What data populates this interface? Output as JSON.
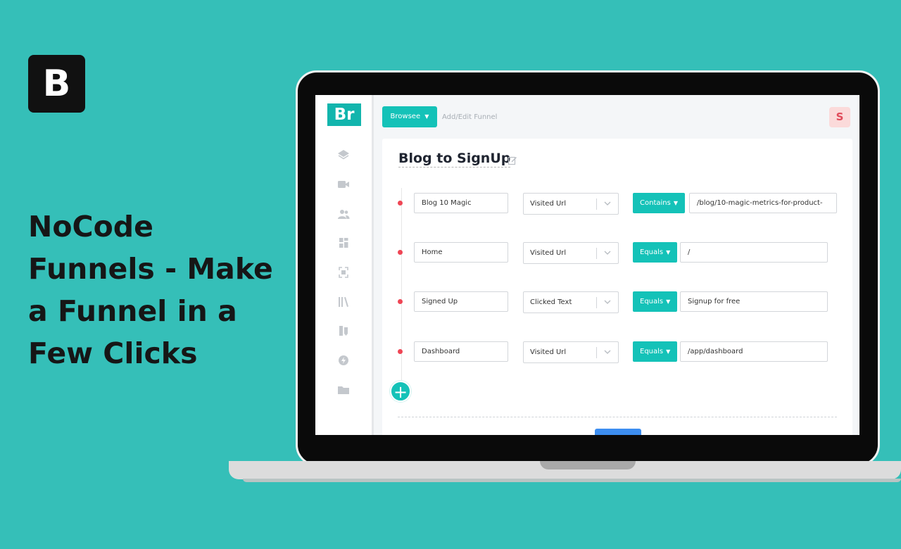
{
  "brand": {
    "badge_letter": "B"
  },
  "headline": {
    "text": "NoCode Funnels - Make a Funnel in a Few Clicks"
  },
  "app": {
    "logo": "Br",
    "project_button": "Browsee",
    "breadcrumb": "Add/Edit Funnel",
    "user_avatar": "S",
    "sidebar_icons": [
      "layers-icon",
      "video-icon",
      "users-icon",
      "dashboard-icon",
      "heatmap-icon",
      "library-icon",
      "tag-icon",
      "lightning-icon",
      "folder-icon"
    ]
  },
  "funnel": {
    "title": "Blog to SignUp",
    "steps": [
      {
        "name": "Blog 10 Magic",
        "event": "Visited Url",
        "operator": "Contains",
        "value": "/blog/10-magic-metrics-for-product-"
      },
      {
        "name": "Home",
        "event": "Visited Url",
        "operator": "Equals",
        "value": "/"
      },
      {
        "name": "Signed Up",
        "event": "Clicked Text",
        "operator": "Equals",
        "value": "Signup for free"
      },
      {
        "name": "Dashboard",
        "event": "Visited Url",
        "operator": "Equals",
        "value": "/app/dashboard"
      }
    ],
    "add_step_label": "+"
  },
  "colors": {
    "background": "#35bfb8",
    "accent": "#14c2b8",
    "step_dot": "#ef4655",
    "avatar_bg": "#fbdada"
  }
}
